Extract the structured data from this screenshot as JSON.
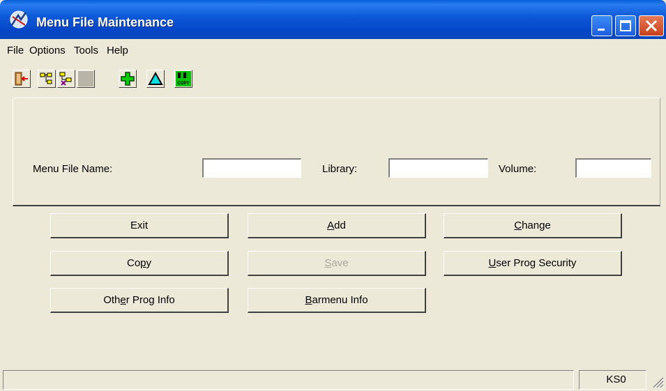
{
  "window": {
    "title": "Menu File Maintenance",
    "controls": {
      "minimize_icon": "minimize-icon",
      "maximize_icon": "maximize-icon",
      "close_icon": "close-icon"
    }
  },
  "menubar": {
    "items": [
      {
        "label": "File"
      },
      {
        "label": "Options"
      },
      {
        "label": "Tools"
      },
      {
        "label": "Help"
      }
    ]
  },
  "toolbar": {
    "tools": [
      {
        "icon": "exit-door-icon"
      },
      {
        "icon": "tree-structure-icon"
      },
      {
        "icon": "tree-tools-icon"
      },
      {
        "icon": "blank-disabled-icon"
      },
      {
        "icon": "add-plus-icon"
      },
      {
        "icon": "change-triangle-icon"
      },
      {
        "icon": "copy-icon",
        "caption": "COPY"
      }
    ]
  },
  "criteria": {
    "menu_file_name": {
      "label": "Menu File Name:",
      "value": ""
    },
    "library": {
      "label": "Library:",
      "value": ""
    },
    "volume": {
      "label": "Volume:",
      "value": ""
    }
  },
  "buttons": {
    "exit": {
      "label": "Exit"
    },
    "add": {
      "pre": "",
      "key": "A",
      "post": "dd"
    },
    "change": {
      "pre": "",
      "key": "C",
      "post": "hange"
    },
    "copy": {
      "pre": "Co",
      "key": "p",
      "post": "y"
    },
    "save": {
      "pre": "",
      "key": "S",
      "post": "ave",
      "disabled": true
    },
    "user_prog_security": {
      "pre": "",
      "key": "U",
      "post": "ser Prog Security"
    },
    "other_prog_info": {
      "pre": "Oth",
      "key": "e",
      "post": "r Prog Info"
    },
    "barmenu_info": {
      "pre": "",
      "key": "B",
      "post": "armenu Info"
    }
  },
  "statusbar": {
    "message": "",
    "code": "KS0"
  },
  "colors": {
    "titlebar": "#0647c8",
    "face": "#ece9d8",
    "close_button": "#c6401c",
    "disabled_text": "#a8a8a0"
  }
}
